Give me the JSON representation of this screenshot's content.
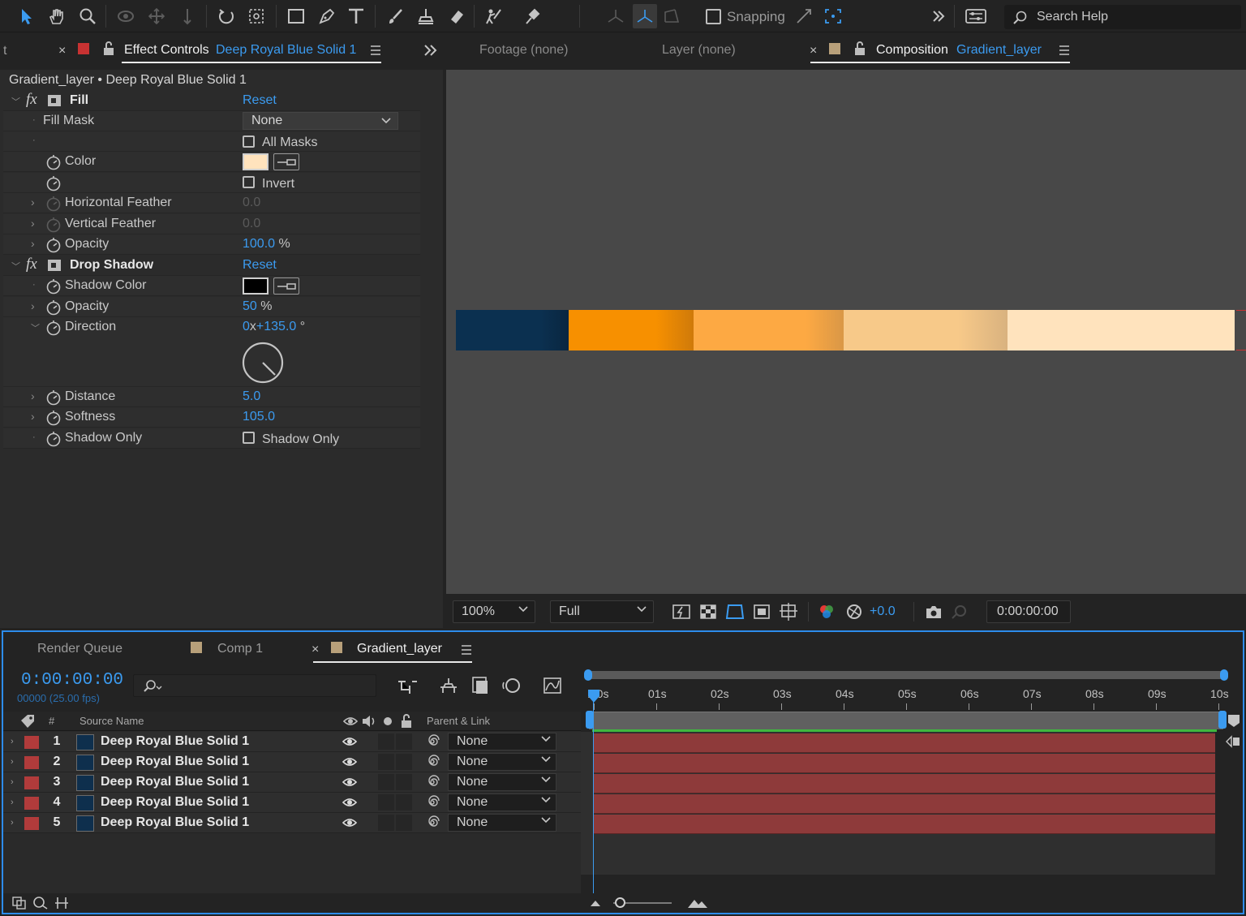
{
  "toolbar": {
    "tools": [
      "selection-tool",
      "hand-tool",
      "zoom-tool",
      "orbit-camera-tool",
      "pan-behind-tool",
      "dolly-tool",
      "rotation-tool",
      "anchor-tool",
      "rectangle-tool",
      "pen-tool",
      "type-tool",
      "brush-tool",
      "clone-stamp-tool",
      "eraser-tool",
      "roto-brush-tool",
      "puppet-pin-tool"
    ],
    "snapping_label": "Snapping",
    "search_placeholder": "Search Help"
  },
  "effect_controls": {
    "left_tab_stub": "t",
    "tab_title": "Effect Controls",
    "tab_layer": "Deep Royal Blue Solid 1",
    "breadcrumb": "Gradient_layer • Deep Royal Blue Solid 1",
    "fill": {
      "name": "Fill",
      "reset": "Reset",
      "fill_mask_label": "Fill Mask",
      "fill_mask_value": "None",
      "all_masks_label": "All Masks",
      "color_label": "Color",
      "color_value": "#ffe3bd",
      "invert_label": "Invert",
      "horizontal_feather_label": "Horizontal Feather",
      "horizontal_feather_value": "0.0",
      "vertical_feather_label": "Vertical Feather",
      "vertical_feather_value": "0.0",
      "opacity_label": "Opacity",
      "opacity_value": "100.0",
      "opacity_unit": "%"
    },
    "drop_shadow": {
      "name": "Drop Shadow",
      "reset": "Reset",
      "shadow_color_label": "Shadow Color",
      "shadow_color_value": "#000000",
      "opacity_label": "Opacity",
      "opacity_value": "50",
      "opacity_unit": "%",
      "direction_label": "Direction",
      "direction_rev": "0",
      "direction_x": "x",
      "direction_deg": "+135.0",
      "direction_unit": "°",
      "distance_label": "Distance",
      "distance_value": "5.0",
      "softness_label": "Softness",
      "softness_value": "105.0",
      "shadow_only_label": "Shadow Only",
      "shadow_only_check_label": "Shadow Only"
    }
  },
  "composition": {
    "footage_tab": "Footage",
    "footage_value": "(none)",
    "layer_tab": "Layer",
    "layer_value": "(none)",
    "comp_tab": "Composition",
    "comp_name": "Gradient_layer",
    "strip_colors": [
      "#0b3050",
      "#f79000",
      "#fda943",
      "#f7c989",
      "#ffe3bd"
    ],
    "zoom_value": "100%",
    "resolution_value": "Full",
    "exposure_value": "+0.0",
    "timecode_value": "0:00:00:00"
  },
  "timeline": {
    "tabs": [
      "Render Queue",
      "Comp 1",
      "Gradient_layer"
    ],
    "current_time": "0:00:00:00",
    "frame_info": "00000 (25.00 fps)",
    "columns": {
      "number": "#",
      "source_name": "Source Name",
      "parent_link": "Parent & Link"
    },
    "ruler_ticks": [
      ":00s",
      "01s",
      "02s",
      "03s",
      "04s",
      "05s",
      "06s",
      "07s",
      "08s",
      "09s",
      "10s"
    ],
    "layers": [
      {
        "num": "1",
        "name": "Deep Royal Blue Solid 1",
        "parent": "None"
      },
      {
        "num": "2",
        "name": "Deep Royal Blue Solid 1",
        "parent": "None"
      },
      {
        "num": "3",
        "name": "Deep Royal Blue Solid 1",
        "parent": "None"
      },
      {
        "num": "4",
        "name": "Deep Royal Blue Solid 1",
        "parent": "None"
      },
      {
        "num": "5",
        "name": "Deep Royal Blue Solid 1",
        "parent": "None"
      }
    ]
  }
}
